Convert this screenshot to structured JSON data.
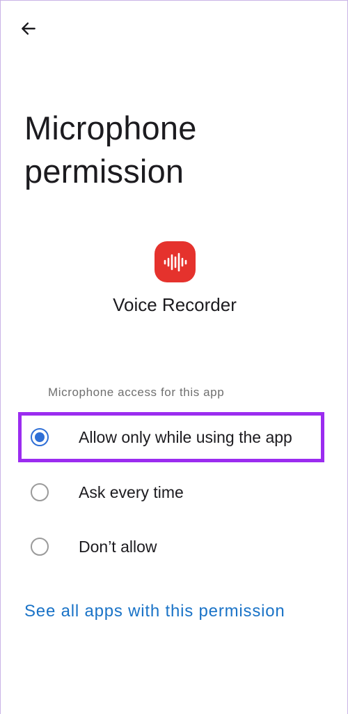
{
  "header": {
    "back_icon": "arrow-left-icon",
    "title": "Microphone permission"
  },
  "app": {
    "icon": "voice-recorder-waveform-icon",
    "icon_color": "#e5322d",
    "name": "Voice Recorder"
  },
  "permission": {
    "section_label": "Microphone access for this app",
    "options": [
      {
        "label": "Allow only while using the app",
        "selected": true
      },
      {
        "label": "Ask every time",
        "selected": false
      },
      {
        "label": "Don’t allow",
        "selected": false
      }
    ]
  },
  "link": {
    "label": "See all apps with this permission",
    "color": "#1a73c7"
  },
  "colors": {
    "radio_selected": "#2f6fd6",
    "highlight": "#9b2cf0"
  }
}
